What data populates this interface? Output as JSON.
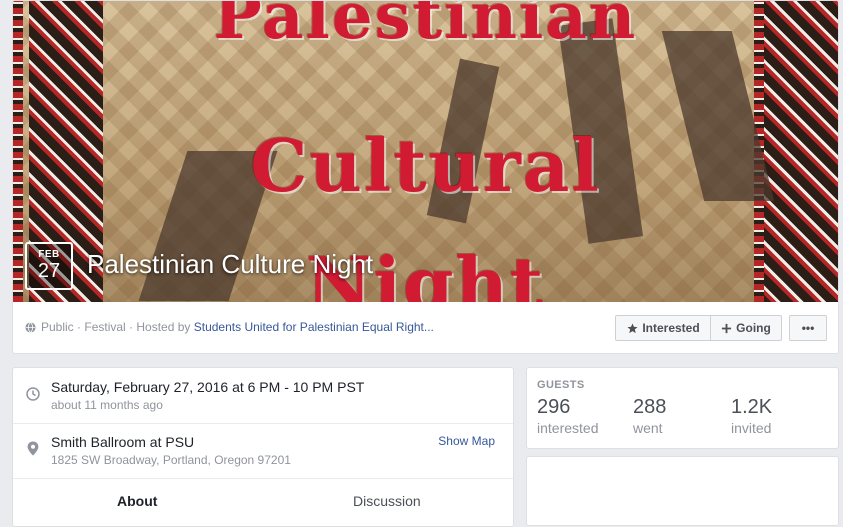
{
  "event": {
    "month": "FEB",
    "day": "27",
    "title": "Palestinian Culture Night",
    "cover_art": [
      "Palestinian",
      "Cultural",
      "Night"
    ],
    "privacy": "Public",
    "category": "Festival",
    "hosted_by_prefix": "Hosted by",
    "host": "Students United for Palestinian Equal Right..."
  },
  "actions": {
    "interested_label": "Interested",
    "going_label": "Going",
    "more_label": "•••"
  },
  "details": {
    "datetime": "Saturday, February 27, 2016 at 6 PM - 10 PM PST",
    "relative_time": "about 11 months ago",
    "venue": "Smith Ballroom at PSU",
    "address": "1825 SW Broadway, Portland, Oregon 97201",
    "show_map_label": "Show Map"
  },
  "tabs": {
    "about": "About",
    "discussion": "Discussion"
  },
  "guests": {
    "title": "GUESTS",
    "stats": [
      {
        "count": "296",
        "label": "interested"
      },
      {
        "count": "288",
        "label": "went"
      },
      {
        "count": "1.2K",
        "label": "invited"
      }
    ]
  },
  "colors": {
    "link": "#365899",
    "cover_text": "#d01b33",
    "page_bg": "#e9ebee"
  }
}
